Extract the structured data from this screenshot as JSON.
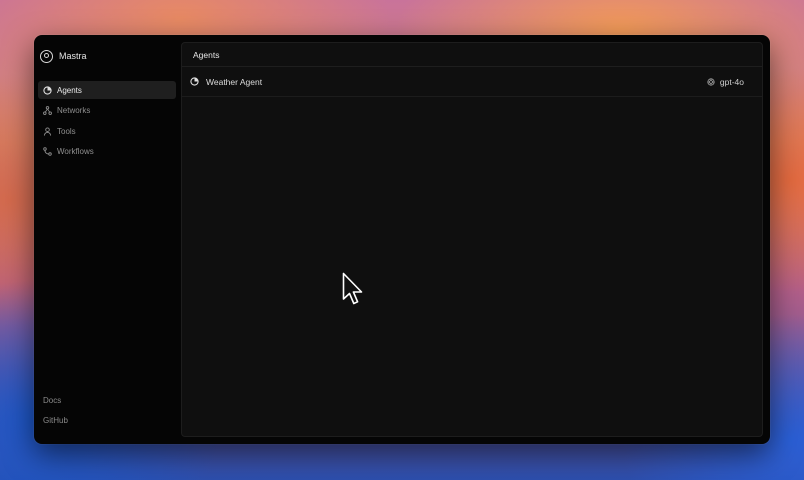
{
  "app": {
    "name": "Mastra"
  },
  "sidebar": {
    "items": [
      {
        "label": "Agents",
        "icon": "agent-icon",
        "active": true
      },
      {
        "label": "Networks",
        "icon": "network-icon",
        "active": false
      },
      {
        "label": "Tools",
        "icon": "tools-icon",
        "active": false
      },
      {
        "label": "Workflows",
        "icon": "workflow-icon",
        "active": false
      }
    ],
    "footer": [
      {
        "label": "Docs"
      },
      {
        "label": "GitHub"
      }
    ]
  },
  "main": {
    "title": "Agents",
    "agents": [
      {
        "name": "Weather Agent",
        "model": "gpt-4o",
        "icon": "agent-icon",
        "model_icon": "openai-icon"
      }
    ]
  },
  "colors": {
    "window_bg": "#050505",
    "panel_bg": "#0f0f0f",
    "active_item_bg": "#1f1f1f"
  }
}
